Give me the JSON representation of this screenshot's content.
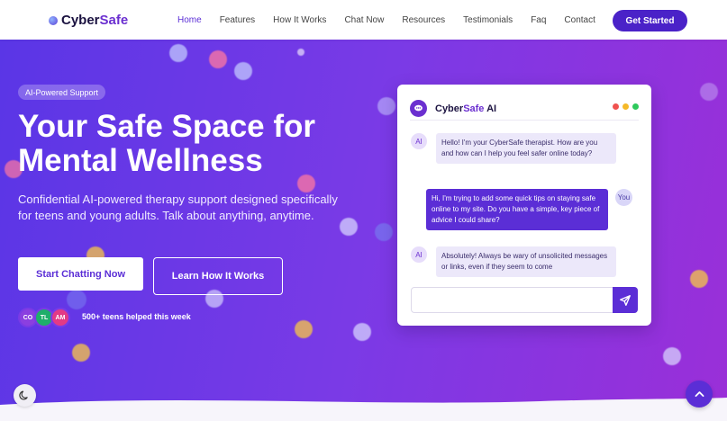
{
  "nav": {
    "brand_part1": "Cyber",
    "brand_part2": "Safe",
    "links": [
      "Home",
      "Features",
      "How It Works",
      "Chat Now",
      "Resources",
      "Testimonials",
      "Faq",
      "Contact"
    ],
    "cta": "Get Started"
  },
  "hero": {
    "badge": "AI-Powered Support",
    "title_line1": "Your Safe Space for",
    "title_line2": "Mental Wellness",
    "subtitle": "Confidential AI-powered therapy support designed specifically for teens and young adults. Talk about anything, anytime.",
    "primary_button": "Start Chatting Now",
    "secondary_button": "Learn How It Works",
    "avatars": [
      {
        "initials": "CO",
        "color": "#8b3fe0"
      },
      {
        "initials": "TL",
        "color": "#1fae6a"
      },
      {
        "initials": "AM",
        "color": "#e33a86"
      }
    ],
    "helped_text": "500+ teens helped this week"
  },
  "chat": {
    "title_part1": "CyberSafe",
    "title_part2": "Safe",
    "title_part3": "AI",
    "window_dot_colors": [
      "#f0524f",
      "#f5b928",
      "#2ec95c"
    ],
    "ai_label": "AI",
    "you_label": "You",
    "messages": [
      {
        "role": "ai",
        "text": "Hello! I'm your CyberSafe therapist. How are you and how can I help you feel safer online today?"
      },
      {
        "role": "user",
        "text": "Hi, I'm trying to add some quick tips on staying safe online to my site. Do you have a simple, key piece of advice I could share?"
      },
      {
        "role": "ai",
        "text": "Absolutely! Always be wary of unsolicited messages or links, even if they seem to come"
      }
    ],
    "input_value": "",
    "input_placeholder": ""
  },
  "colors": {
    "accent": "#5b2ed6",
    "brand_purple": "#6b2fd0"
  },
  "icons": {
    "theme_toggle": "moon-icon",
    "scroll_top": "chevron-up-icon",
    "send": "send-icon",
    "chat": "chat-bubble-icon"
  }
}
